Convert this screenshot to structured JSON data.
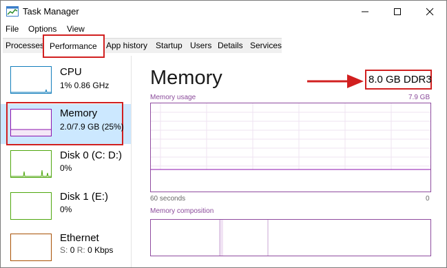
{
  "window": {
    "title": "Task Manager"
  },
  "menu": {
    "file": "File",
    "options": "Options",
    "view": "View"
  },
  "tabs": {
    "processes": "Processes",
    "performance": "Performance",
    "app_history": "App history",
    "startup": "Startup",
    "users": "Users",
    "details": "Details",
    "services": "Services"
  },
  "sidebar": {
    "items": [
      {
        "name": "CPU",
        "sub": "1% 0.86 GHz",
        "color": "#117dbb"
      },
      {
        "name": "Memory",
        "sub": "2.0/7.9 GB (25%)",
        "color": "#8b12ae"
      },
      {
        "name": "Disk 0 (C: D:)",
        "sub": "0%",
        "color": "#4da60c"
      },
      {
        "name": "Disk 1 (E:)",
        "sub": "0%",
        "color": "#4da60c"
      },
      {
        "name": "Ethernet",
        "sub_s": "S:",
        "sub_s_val": "0",
        "sub_r": "R:",
        "sub_r_val": "0 Kbps",
        "color": "#a74f01"
      }
    ]
  },
  "main": {
    "heading": "Memory",
    "spec": "8.0 GB DDR3",
    "usage_label": "Memory usage",
    "usage_max": "7.9 GB",
    "time_left": "60 seconds",
    "time_right": "0",
    "composition_label": "Memory composition",
    "usage_fraction": 0.25
  },
  "colors": {
    "memory": "#8b12ae",
    "annotation": "#d11f1f",
    "selection": "#cce8ff"
  }
}
